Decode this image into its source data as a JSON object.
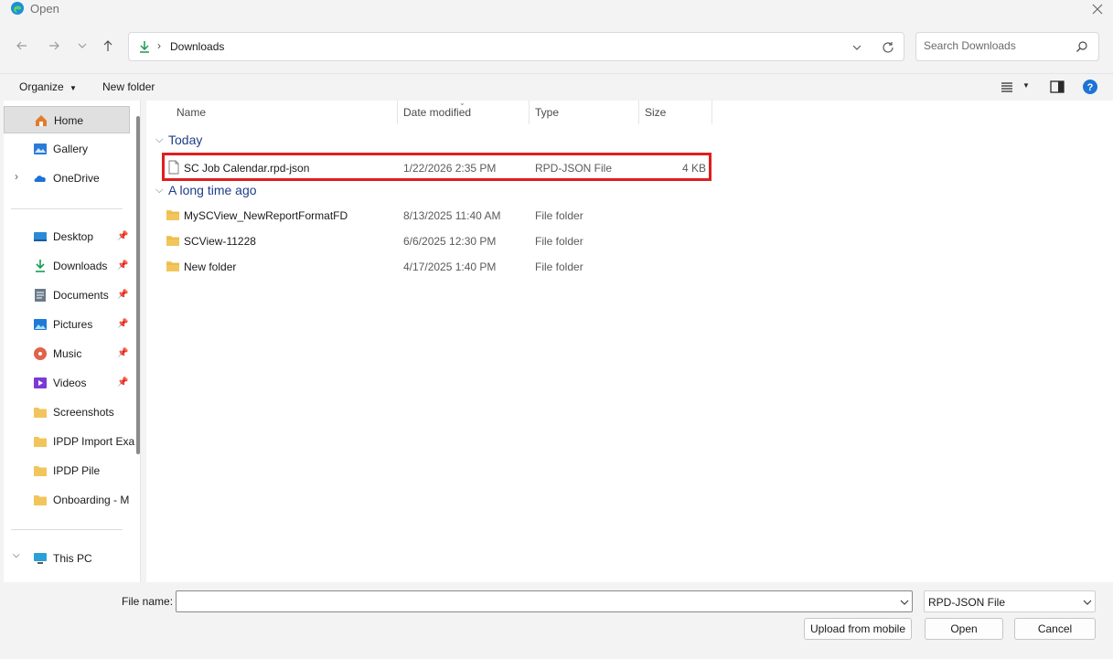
{
  "window": {
    "title": "Open"
  },
  "navigation": {
    "address_location": "Downloads",
    "search_placeholder": "Search Downloads"
  },
  "toolbar": {
    "organize_label": "Organize",
    "new_folder_label": "New folder"
  },
  "sidebar": {
    "items": [
      {
        "label": "Home",
        "icon": "home-icon",
        "selected": true
      },
      {
        "label": "Gallery",
        "icon": "gallery-icon"
      },
      {
        "label": "OneDrive",
        "icon": "onedrive-icon",
        "expandable": true
      },
      {
        "label": "Desktop",
        "icon": "desktop-icon",
        "pinned": true
      },
      {
        "label": "Downloads",
        "icon": "download-icon",
        "pinned": true
      },
      {
        "label": "Documents",
        "icon": "documents-icon",
        "pinned": true
      },
      {
        "label": "Pictures",
        "icon": "pictures-icon",
        "pinned": true
      },
      {
        "label": "Music",
        "icon": "music-icon",
        "pinned": true
      },
      {
        "label": "Videos",
        "icon": "videos-icon",
        "pinned": true
      },
      {
        "label": "Screenshots",
        "icon": "folder-icon"
      },
      {
        "label": "IPDP Import Exa",
        "icon": "folder-icon"
      },
      {
        "label": "IPDP Pile",
        "icon": "folder-icon"
      },
      {
        "label": "Onboarding - M",
        "icon": "folder-icon"
      },
      {
        "label": "This PC",
        "icon": "this-pc-icon",
        "expandable": true
      }
    ]
  },
  "file_list": {
    "columns": [
      "Name",
      "Date modified",
      "Type",
      "Size"
    ],
    "groups": [
      {
        "label": "Today",
        "files": [
          {
            "name": "SC Job Calendar.rpd-json",
            "date": "1/22/2026 2:35 PM",
            "type": "RPD-JSON File",
            "size": "4 KB",
            "icon": "file-icon",
            "highlighted": true
          }
        ]
      },
      {
        "label": "A long time ago",
        "files": [
          {
            "name": "MySCView_NewReportFormatFD",
            "date": "8/13/2025 11:40 AM",
            "type": "File folder",
            "size": "",
            "icon": "folder-icon"
          },
          {
            "name": "SCView-11228",
            "date": "6/6/2025 12:30 PM",
            "type": "File folder",
            "size": "",
            "icon": "folder-icon"
          },
          {
            "name": "New folder",
            "date": "4/17/2025 1:40 PM",
            "type": "File folder",
            "size": "",
            "icon": "folder-icon"
          }
        ]
      }
    ],
    "highlight_color": "#e01e1e"
  },
  "footer": {
    "file_name_label": "File name:",
    "file_name_value": "",
    "file_type_selected": "RPD-JSON File",
    "upload_label": "Upload from mobile",
    "open_label": "Open",
    "cancel_label": "Cancel"
  },
  "colors": {
    "accent": "#0067c0",
    "group_heading": "#1e3e8a",
    "folder": "#f2c55c"
  }
}
